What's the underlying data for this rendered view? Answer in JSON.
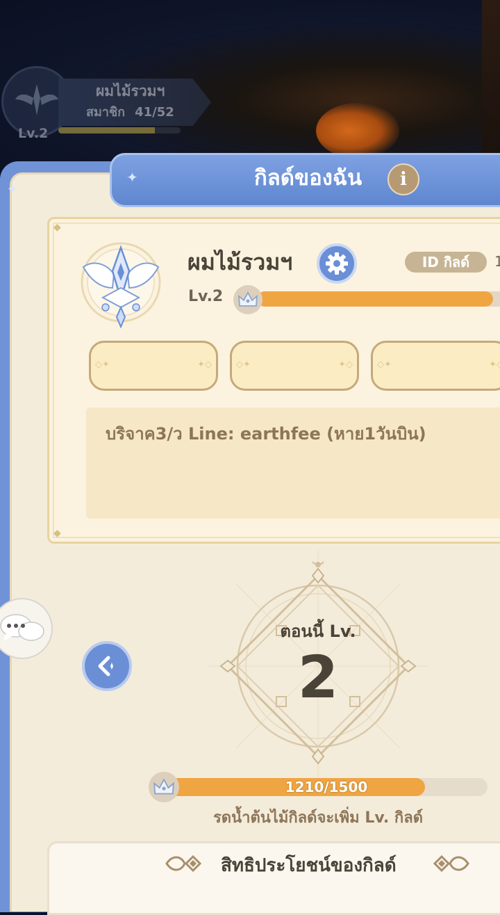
{
  "top_guild": {
    "name": "ผมไม้รวมฯ",
    "members_label": "สมาชิก",
    "members_count": "41/52",
    "level": "Lv.2",
    "bar_fraction": 0.79
  },
  "header": {
    "title": "กิลด์ของฉัน",
    "info_icon": "i"
  },
  "guild": {
    "name": "ผมไม้รวมฯ",
    "id_label": "ID กิลด์",
    "id_value": "1",
    "level": "Lv.2",
    "level_progress_fraction": 0.97,
    "notice": "บริจาค3/ว Line: earthfee (หาย1วันบิน)"
  },
  "level_display": {
    "now_label": "ตอนนี้ Lv.",
    "value": "2"
  },
  "water": {
    "progress_text": "1210/1500",
    "current": 1210,
    "max": 1500,
    "hint": "รดน้ำต้นไม้กิลด์จะเพิ่ม Lv. กิลด์"
  },
  "benefits": {
    "title": "สิทธิประโยชน์ของกิลด์"
  },
  "icons": {
    "gear": "gear-icon",
    "chat": "chat-bubbles-icon",
    "back": "back-arrow-icon",
    "crown": "crown-icon",
    "info": "info-icon"
  },
  "colors": {
    "accent_blue": "#6a8fd6",
    "progress_orange": "#f0a543",
    "panel_cream": "#f4ecda",
    "text_dark": "#4a4338"
  }
}
